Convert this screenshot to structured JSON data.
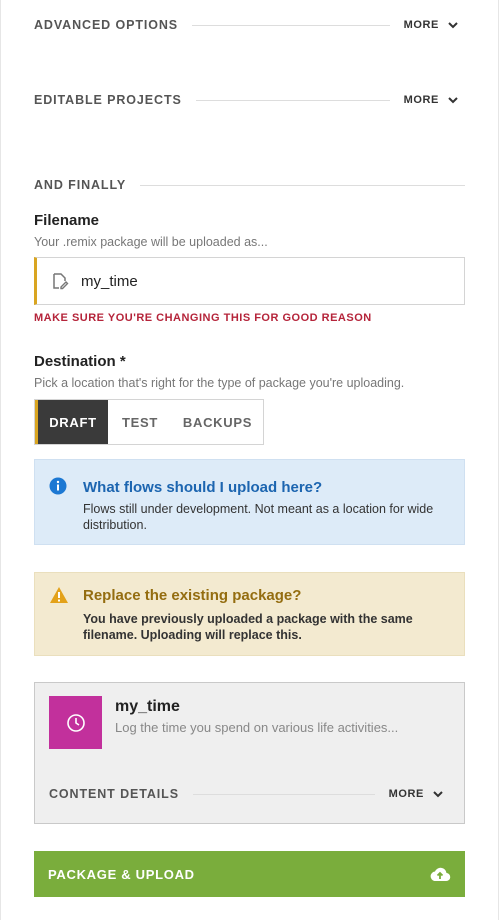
{
  "sections": {
    "advanced": {
      "title": "ADVANCED OPTIONS",
      "more": "MORE"
    },
    "editable": {
      "title": "EDITABLE PROJECTS",
      "more": "MORE"
    },
    "finally": {
      "title": "AND FINALLY"
    }
  },
  "filename": {
    "label": "Filename",
    "help": "Your .remix package will be uploaded as...",
    "value": "my_time",
    "warning": "MAKE SURE YOU'RE CHANGING THIS FOR GOOD REASON"
  },
  "destination": {
    "label": "Destination *",
    "help": "Pick a location that's right for the type of package you're uploading.",
    "options": [
      "DRAFT",
      "TEST",
      "BACKUPS"
    ],
    "selected": "DRAFT"
  },
  "info": {
    "title": "What flows should I upload here?",
    "body": "Flows still under development. Not meant as a location for wide distribution."
  },
  "warning_box": {
    "title": "Replace the existing package?",
    "body": "You have previously uploaded a package with the same filename. Uploading will replace this."
  },
  "card": {
    "title": "my_time",
    "description": "Log the time you spend on various life activities...",
    "details_title": "CONTENT DETAILS",
    "more": "MORE",
    "icon": "clock-icon",
    "icon_bg": "#c2309c"
  },
  "upload": {
    "label": "PACKAGE & UPLOAD",
    "icon": "cloud-upload-icon",
    "bg": "#7aad3c"
  },
  "colors": {
    "accent": "#d9a521",
    "error": "#b5243a",
    "info": "#1c65b0",
    "warn": "#946d10"
  }
}
